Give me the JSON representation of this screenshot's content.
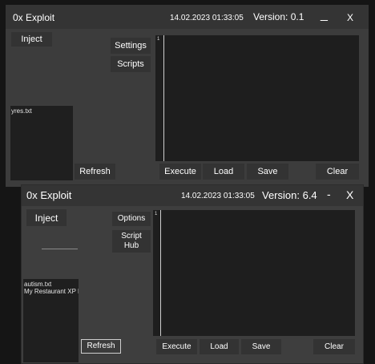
{
  "window1": {
    "title": "0x Exploit",
    "datetime": "14.02.2023 01:33:05",
    "version": "Version: 0.1",
    "minimize": "_",
    "close": "X",
    "inject": "Inject",
    "settings": "Settings",
    "scripts": "Scripts",
    "script_list": [
      "yres.txt"
    ],
    "refresh": "Refresh",
    "line_number": "1",
    "execute": "Execute",
    "load": "Load",
    "save": "Save",
    "clear": "Clear"
  },
  "window2": {
    "title": "0x Exploit",
    "datetime": "14.02.2023 01:33:05",
    "version": "Version: 6.4",
    "minimize": "-",
    "close": "X",
    "inject": "Inject",
    "options": "Options",
    "script_hub": "Script Hub",
    "script_list": [
      "autism.txt",
      "My Restaurant XP F"
    ],
    "refresh": "Refresh",
    "line_number": "1",
    "execute": "Execute",
    "load": "Load",
    "save": "Save",
    "clear": "Clear"
  },
  "colors": {
    "background": "#151515",
    "window": "#3c3c3c",
    "titlebar": "#343434",
    "button": "#333333",
    "editor": "#1e1e1e",
    "text": "#ffffff"
  }
}
